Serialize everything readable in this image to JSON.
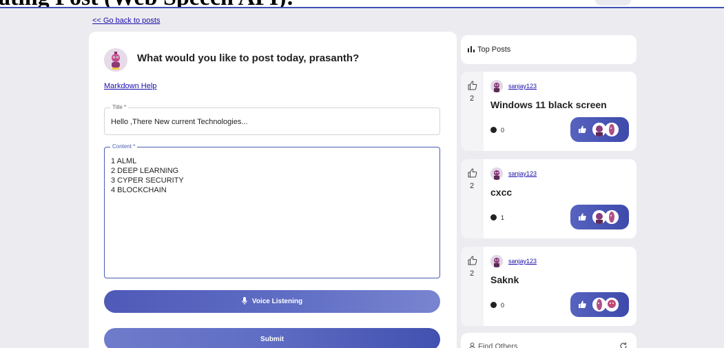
{
  "page": {
    "heading": "ating Post (Web Speech API):"
  },
  "nav": {
    "back_label": "<< Go back to posts"
  },
  "composer": {
    "prompt": "What would you like to post today, prasanth?",
    "markdown_help": "Markdown Help",
    "title_legend": "Title *",
    "title_value": "Hello ,There New current Technologies...",
    "content_legend": "Content *",
    "content_lines": [
      "1 ALML",
      "2 DEEP LEARNING",
      "3 CYPER SECURITY",
      "4 BLOCKCHAIN"
    ],
    "voice_label": "Voice Listening",
    "submit_label": "Submit"
  },
  "sidebar": {
    "top_posts_title": "Top Posts",
    "find_others_title": "Find Others",
    "posts": [
      {
        "username": "sanjay123",
        "title": "Windows 11 black screen",
        "likes": "2",
        "comments": "0"
      },
      {
        "username": "sanjay123",
        "title": "cxcc",
        "likes": "2",
        "comments": "1"
      },
      {
        "username": "sanjay123",
        "title": "Saknk",
        "likes": "2",
        "comments": "0"
      }
    ]
  },
  "icons": {
    "thumb": "thumb-up-outline-icon",
    "mic": "microphone-icon",
    "chart": "bar-chart-icon",
    "comment": "comment-icon",
    "refresh": "refresh-icon",
    "person": "person-icon"
  },
  "colors": {
    "accent": "#3f51b5",
    "button_gradient_start": "#4f5ab8",
    "button_gradient_end": "#7985d0",
    "link": "#1a0dab",
    "background": "#ececf0"
  }
}
